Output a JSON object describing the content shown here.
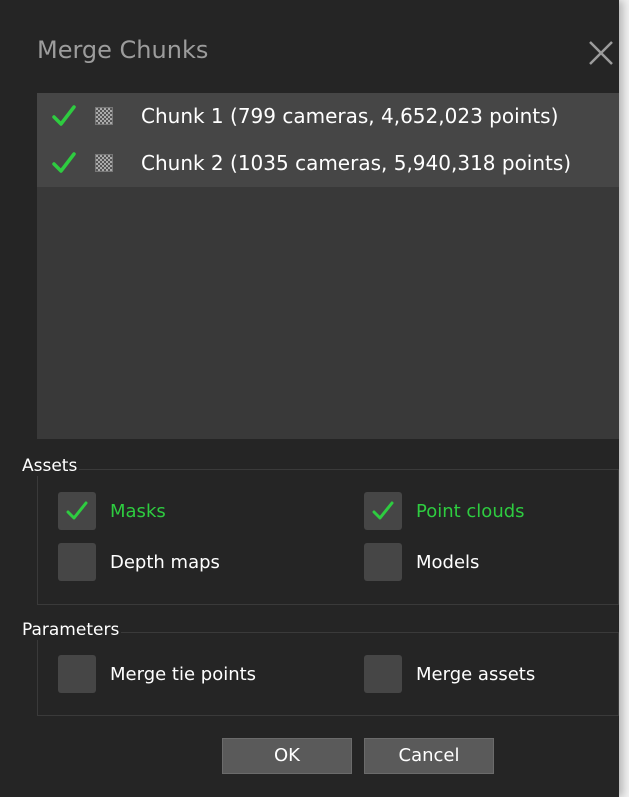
{
  "dialog": {
    "title": "Merge Chunks",
    "close_icon": "close-icon"
  },
  "chunks": [
    {
      "label": "Chunk 1 (799 cameras, 4,652,023 points)",
      "checked": true,
      "icon": "grid-icon"
    },
    {
      "label": "Chunk 2 (1035 cameras, 5,940,318 points)",
      "checked": true,
      "icon": "grid-icon"
    }
  ],
  "assets": {
    "label": "Assets",
    "masks": {
      "label": "Masks",
      "checked": true
    },
    "point_clouds": {
      "label": "Point clouds",
      "checked": true
    },
    "depth_maps": {
      "label": "Depth maps",
      "checked": false
    },
    "models": {
      "label": "Models",
      "checked": false
    }
  },
  "parameters": {
    "label": "Parameters",
    "merge_tie_points": {
      "label": "Merge tie points",
      "checked": false
    },
    "merge_assets": {
      "label": "Merge assets",
      "checked": false
    }
  },
  "buttons": {
    "ok": "OK",
    "cancel": "Cancel"
  },
  "colors": {
    "check_green": "#2ecc40",
    "background": "#252525"
  }
}
